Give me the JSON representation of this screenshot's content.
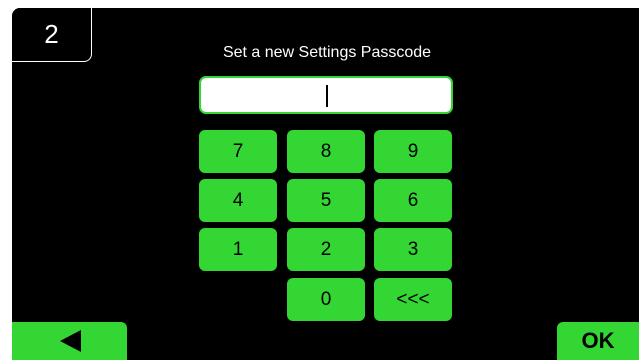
{
  "step_number": "2",
  "prompt": "Set a new Settings Passcode",
  "passcode_value": "",
  "keypad": {
    "k7": "7",
    "k8": "8",
    "k9": "9",
    "k4": "4",
    "k5": "5",
    "k6": "6",
    "k1": "1",
    "k2": "2",
    "k3": "3",
    "k0": "0",
    "backspace": "<<<"
  },
  "footer": {
    "back_icon": "left-triangle-icon",
    "ok_label": "OK"
  },
  "colors": {
    "accent": "#33d633",
    "background": "#000000",
    "field": "#ffffff"
  }
}
